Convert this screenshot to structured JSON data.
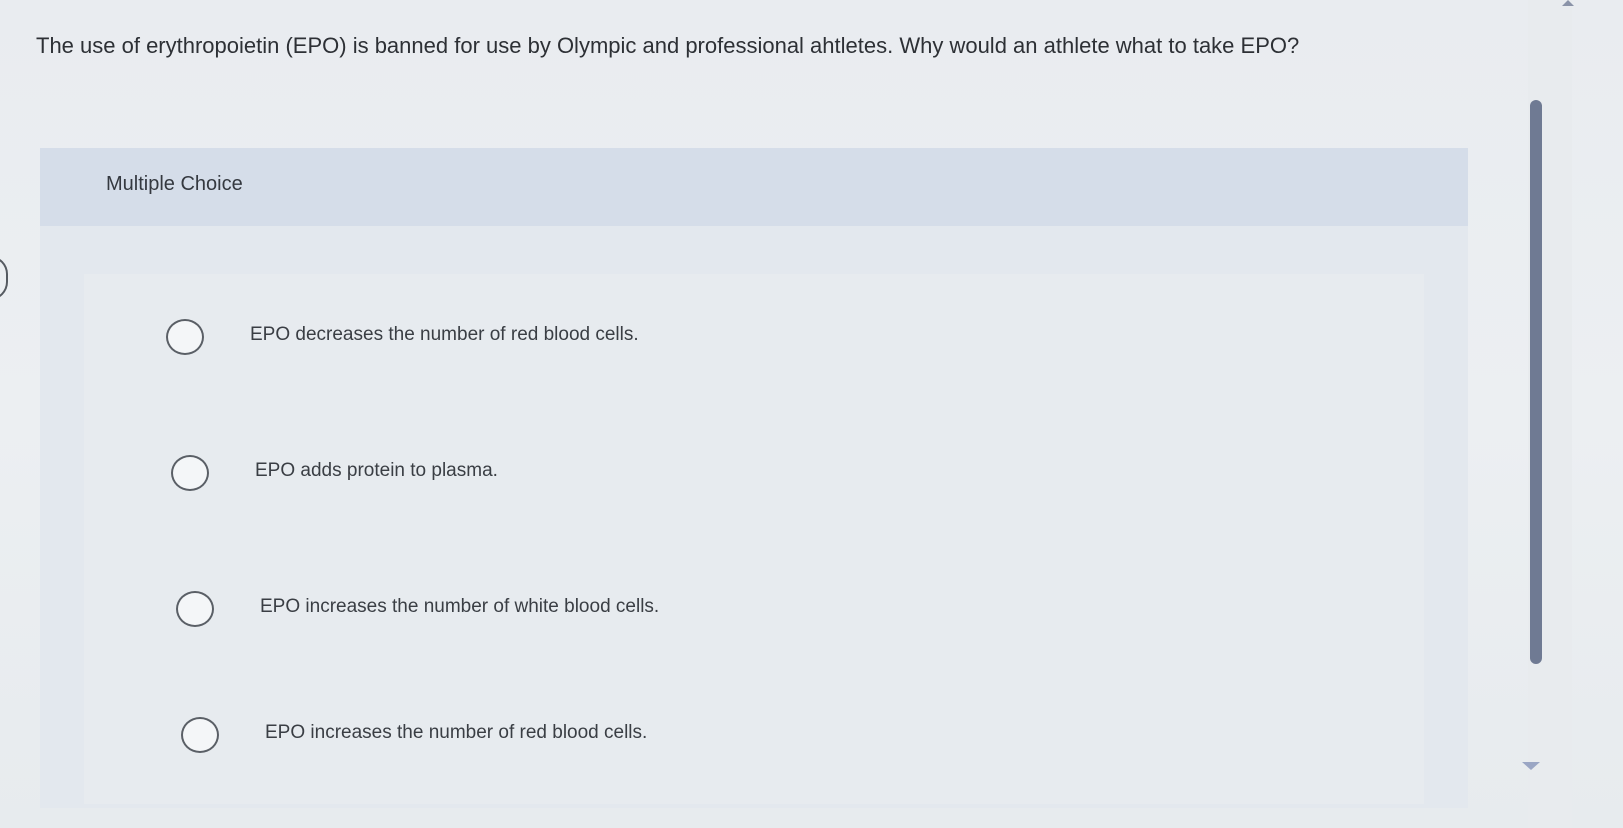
{
  "question": {
    "text": "The use of erythropoietin (EPO) is banned for use by Olympic and professional ahtletes. Why would an athlete what to take EPO?"
  },
  "multiple_choice": {
    "header_label": "Multiple Choice",
    "options": [
      {
        "label": "EPO decreases the number of red blood cells.",
        "selected": false
      },
      {
        "label": "EPO adds protein to plasma.",
        "selected": false
      },
      {
        "label": "EPO increases the number of white blood cells.",
        "selected": false
      },
      {
        "label": "EPO increases the number of red blood cells.",
        "selected": false
      }
    ]
  },
  "colors": {
    "header_band": "#d5dde9",
    "panel": "#e3e8ee",
    "scrollbar_thumb": "#6f7a93",
    "text": "#2d3035"
  },
  "icons": {
    "scroll_up": "scroll-up-arrow-icon",
    "scroll_down": "scroll-down-arrow-icon",
    "radio": "radio-unchecked-icon"
  }
}
